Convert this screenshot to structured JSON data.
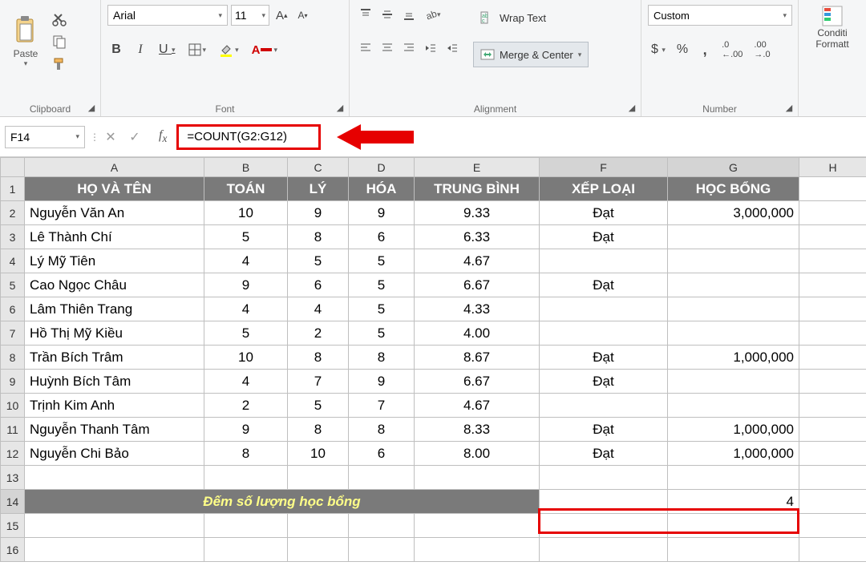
{
  "ribbon": {
    "clipboard": {
      "label": "Clipboard",
      "paste": "Paste"
    },
    "font": {
      "label": "Font",
      "name": "Arial",
      "size": "11",
      "bold": "B",
      "italic": "I",
      "underline": "U"
    },
    "alignment": {
      "label": "Alignment",
      "wrap": "Wrap Text",
      "merge": "Merge & Center"
    },
    "number": {
      "label": "Number",
      "format": "Custom",
      "inc": ".0",
      "dec": ".00"
    },
    "styles": {
      "cond1": "Conditi",
      "cond2": "Formatt"
    }
  },
  "fx": {
    "name_box": "F14",
    "formula": "=COUNT(G2:G12)"
  },
  "columns": [
    "A",
    "B",
    "C",
    "D",
    "E",
    "F",
    "G",
    "H"
  ],
  "header_row": [
    "HỌ VÀ TÊN",
    "TOÁN",
    "LÝ",
    "HÓA",
    "TRUNG BÌNH",
    "XẾP LOẠI",
    "HỌC BỔNG"
  ],
  "rows": [
    {
      "n": "2",
      "name": "Nguyễn Văn An",
      "t": "10",
      "l": "9",
      "h": "9",
      "tb": "9.33",
      "xl": "Đạt",
      "hb": "3,000,000"
    },
    {
      "n": "3",
      "name": "Lê Thành Chí",
      "t": "5",
      "l": "8",
      "h": "6",
      "tb": "6.33",
      "xl": "Đạt",
      "hb": ""
    },
    {
      "n": "4",
      "name": "Lý Mỹ Tiên",
      "t": "4",
      "l": "5",
      "h": "5",
      "tb": "4.67",
      "xl": "",
      "hb": ""
    },
    {
      "n": "5",
      "name": "Cao Ngọc Châu",
      "t": "9",
      "l": "6",
      "h": "5",
      "tb": "6.67",
      "xl": "Đạt",
      "hb": ""
    },
    {
      "n": "6",
      "name": "Lâm Thiên Trang",
      "t": "4",
      "l": "4",
      "h": "5",
      "tb": "4.33",
      "xl": "",
      "hb": ""
    },
    {
      "n": "7",
      "name": "Hồ Thị Mỹ Kiều",
      "t": "5",
      "l": "2",
      "h": "5",
      "tb": "4.00",
      "xl": "",
      "hb": ""
    },
    {
      "n": "8",
      "name": "Trần Bích Trâm",
      "t": "10",
      "l": "8",
      "h": "8",
      "tb": "8.67",
      "xl": "Đạt",
      "hb": "1,000,000"
    },
    {
      "n": "9",
      "name": "Huỳnh Bích Tâm",
      "t": "4",
      "l": "7",
      "h": "9",
      "tb": "6.67",
      "xl": "Đạt",
      "hb": ""
    },
    {
      "n": "10",
      "name": "Trịnh Kim Anh",
      "t": "2",
      "l": "5",
      "h": "7",
      "tb": "4.67",
      "xl": "",
      "hb": ""
    },
    {
      "n": "11",
      "name": "Nguyễn Thanh Tâm",
      "t": "9",
      "l": "8",
      "h": "8",
      "tb": "8.33",
      "xl": "Đạt",
      "hb": "1,000,000"
    },
    {
      "n": "12",
      "name": "Nguyễn Chi Bảo",
      "t": "8",
      "l": "10",
      "h": "6",
      "tb": "8.00",
      "xl": "Đạt",
      "hb": "1,000,000"
    }
  ],
  "summary": {
    "row": "14",
    "label": "Đếm số lượng học bổng",
    "result": "4"
  },
  "blank_rows": [
    "13",
    "15",
    "16"
  ]
}
